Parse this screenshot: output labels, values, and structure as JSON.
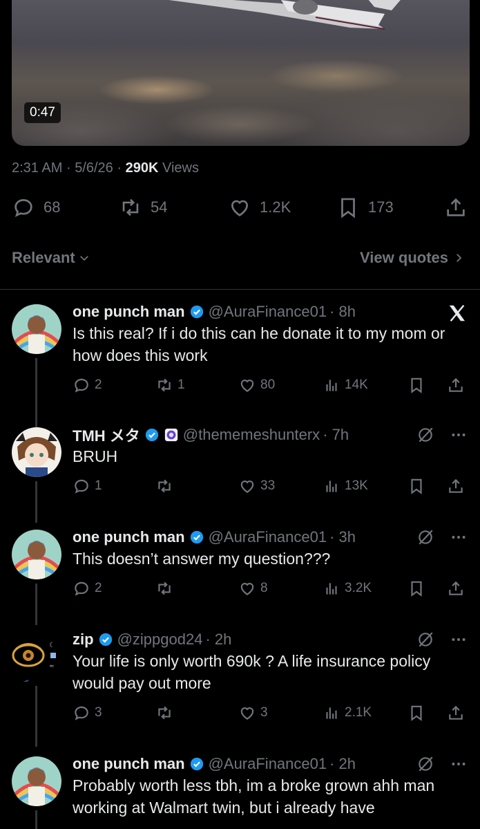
{
  "video": {
    "duration": "0:47"
  },
  "meta": {
    "time": "2:31 AM",
    "sep1": "·",
    "date": "5/6/26",
    "sep2": "·",
    "views_count": "290K",
    "views_label": "Views"
  },
  "actions": {
    "replies": "68",
    "reposts": "54",
    "likes": "1.2K",
    "bookmarks": "173"
  },
  "sort": {
    "label": "Relevant",
    "quotes": "View quotes"
  },
  "replies": [
    {
      "name": "one punch man",
      "handle": "@AuraFinance01",
      "time": "· 8h",
      "text": "Is this real? If i do this can he donate it to my mom or how does this work",
      "replies": "2",
      "reposts": "1",
      "likes": "80",
      "views": "14K"
    },
    {
      "name": "TMH メタ",
      "handle": "@thememeshunterx",
      "time": "· 7h",
      "text": "BRUH",
      "replies": "1",
      "reposts": "",
      "likes": "33",
      "views": "13K"
    },
    {
      "name": "one punch man",
      "handle": "@AuraFinance01",
      "time": "· 3h",
      "text": "This doesn’t answer my question???",
      "replies": "2",
      "reposts": "",
      "likes": "8",
      "views": "3.2K"
    },
    {
      "name": "zip",
      "handle": "@zippgod24",
      "time": "· 2h",
      "text": "Your life is only worth 690k ? A life insurance policy would pay out more",
      "replies": "3",
      "reposts": "",
      "likes": "3",
      "views": "2.1K"
    },
    {
      "name": "one punch man",
      "handle": "@AuraFinance01",
      "time": "· 2h",
      "text": "Probably worth less tbh, im a broke grown ahh man working at Walmart twin, but i already have"
    }
  ],
  "colors": {
    "background": "#000000",
    "text": "#e7e9ea",
    "muted": "#71767b",
    "verified": "#1d9bf0"
  }
}
